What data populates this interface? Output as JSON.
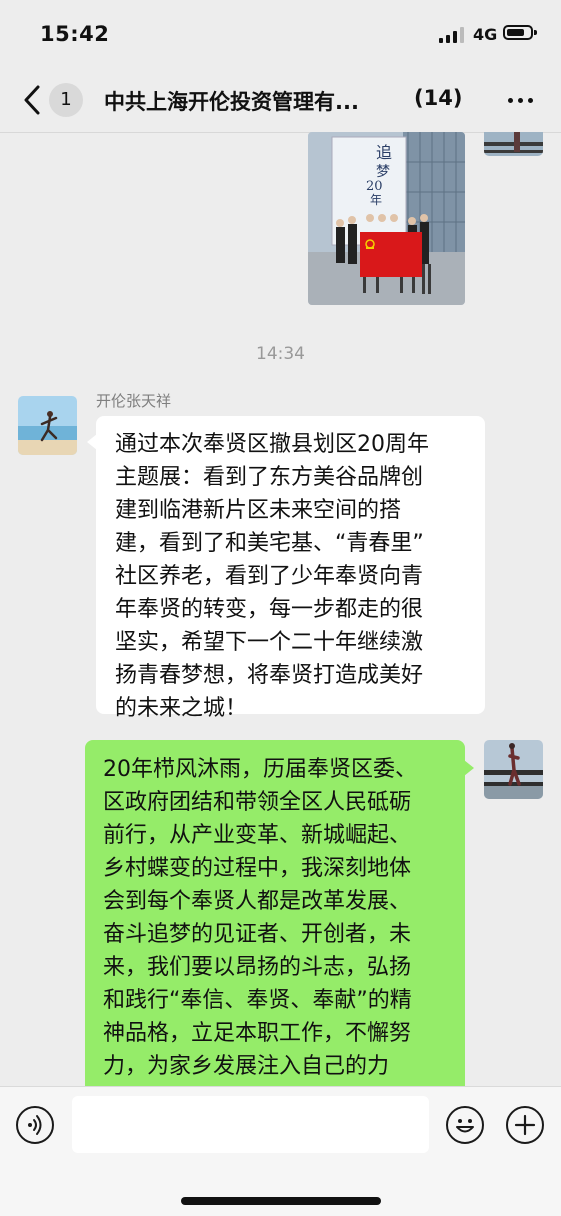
{
  "status_bar": {
    "time": "15:42",
    "network": "4G"
  },
  "header": {
    "unread_count": "1",
    "title": "中共上海开伦投资管理有...",
    "member_count": "(14)"
  },
  "messages": {
    "timestamp": "14:34",
    "incoming": {
      "sender": "开伦张天祥",
      "text": "通过本次奉贤区撤县划区20周年\n主题展：看到了东方美谷品牌创\n建到临港新片区未来空间的搭\n建，看到了和美宅基、“青春里”\n社区养老，看到了少年奉贤向青\n年奉贤的转变，每一步都走的很\n坚实，希望下一个二十年继续激\n扬青春梦想，将奉贤打造成美好\n的未来之城！"
    },
    "outgoing": {
      "text": "20年栉风沐雨，历届奉贤区委、\n区政府团结和带领全区人民砥砺\n前行，从产业变革、新城崛起、\n乡村蝶变的过程中，我深刻地体\n会到每个奉贤人都是改革发展、\n奋斗追梦的见证者、开创者，未\n来，我们要以昂扬的斗志，弘扬\n和践行“奉信、奉贤、奉献”的精\n神品格，立足本职工作，不懈努\n力，为家乡发展注入自己的力\n量！"
    },
    "photo": {
      "poster_text_1": "追",
      "poster_text_2": "梦",
      "poster_text_3": "20",
      "poster_text_4": "年"
    }
  },
  "input_bar": {
    "value": "",
    "placeholder": ""
  },
  "icons": {
    "back": "chevron-left-icon",
    "more": "more-horizontal-icon",
    "voice": "voice-icon",
    "emoji": "emoji-icon",
    "plus": "plus-icon"
  },
  "colors": {
    "background": "#ededed",
    "outgoing_bubble": "#95ec69",
    "incoming_bubble": "#ffffff",
    "muted_text": "#999999"
  }
}
